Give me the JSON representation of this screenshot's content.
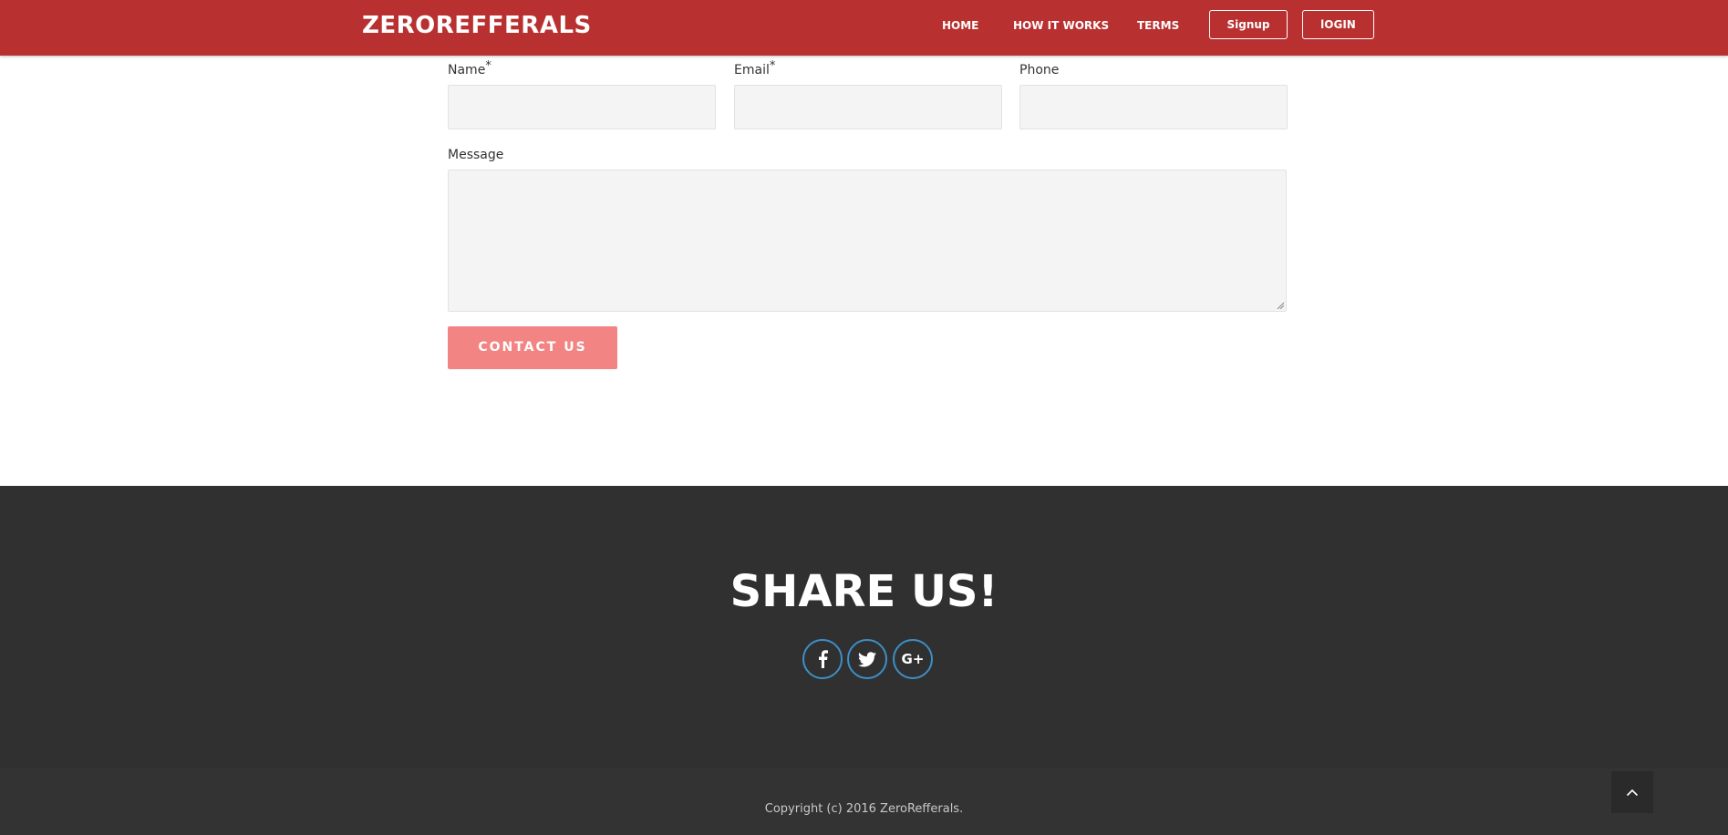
{
  "header": {
    "logo": "ZEROREFFERALS",
    "nav": [
      "HOME",
      "HOW IT WORKS",
      "TERMS"
    ],
    "signup_label": "Signup",
    "login_label": "lOGIN",
    "background_color": "#b83030"
  },
  "form": {
    "name_label": "Name",
    "email_label": "Email",
    "phone_label": "Phone",
    "required_marker": "*",
    "message_label": "Message",
    "submit_label": "CONTACT US",
    "button_color": "#f28583"
  },
  "share": {
    "title": "SHARE US!",
    "social_icons": [
      "facebook-icon",
      "twitter-icon",
      "google-plus-icon"
    ],
    "gplus_glyph": "G+",
    "icon_border_color": "#3e8fc6"
  },
  "footer": {
    "copyright": "Copyright (c) 2016 ZeroRefferals.",
    "back_to_top_icon": "chevron-up-icon"
  }
}
